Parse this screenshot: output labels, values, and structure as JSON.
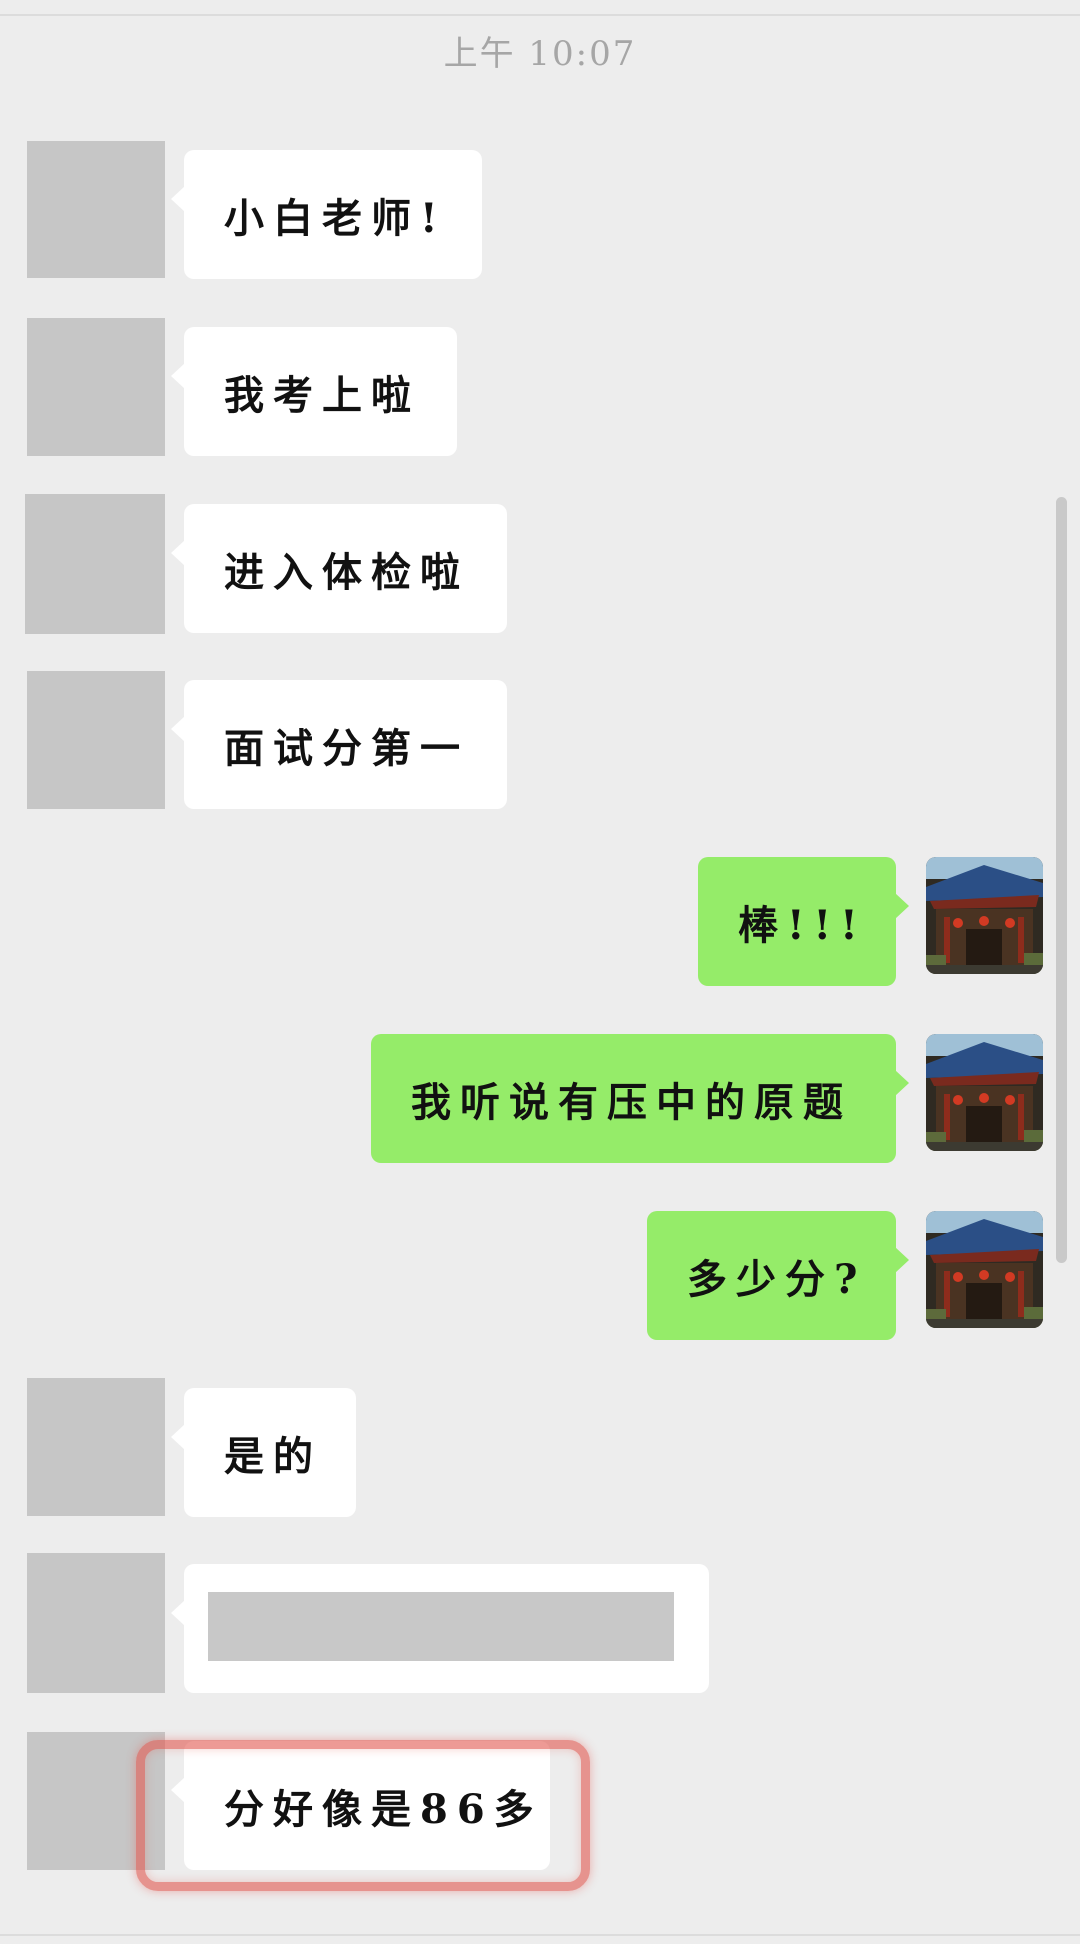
{
  "chat": {
    "timestamp": "上午 10:07",
    "messages": [
      {
        "sender": "other",
        "text": "小白老师!"
      },
      {
        "sender": "other",
        "text": "我考上啦"
      },
      {
        "sender": "other",
        "text": "进入体检啦"
      },
      {
        "sender": "other",
        "text": "面试分第一"
      },
      {
        "sender": "self",
        "text": "棒!!!"
      },
      {
        "sender": "self",
        "text": "我听说有压中的原题"
      },
      {
        "sender": "self",
        "text": "多少分?"
      },
      {
        "sender": "other",
        "text": "是的"
      },
      {
        "sender": "other",
        "text": "",
        "redacted": true
      },
      {
        "sender": "other",
        "text": "分好像是86多",
        "highlighted": true
      }
    ]
  },
  "colors": {
    "background": "#EDEDED",
    "incoming_bubble": "#FFFFFF",
    "outgoing_bubble": "#95EC69",
    "avatar_placeholder": "#C6C6C6",
    "highlight": "#E25C54"
  },
  "icons": {
    "self_avatar": "pagoda-photo-avatar"
  }
}
